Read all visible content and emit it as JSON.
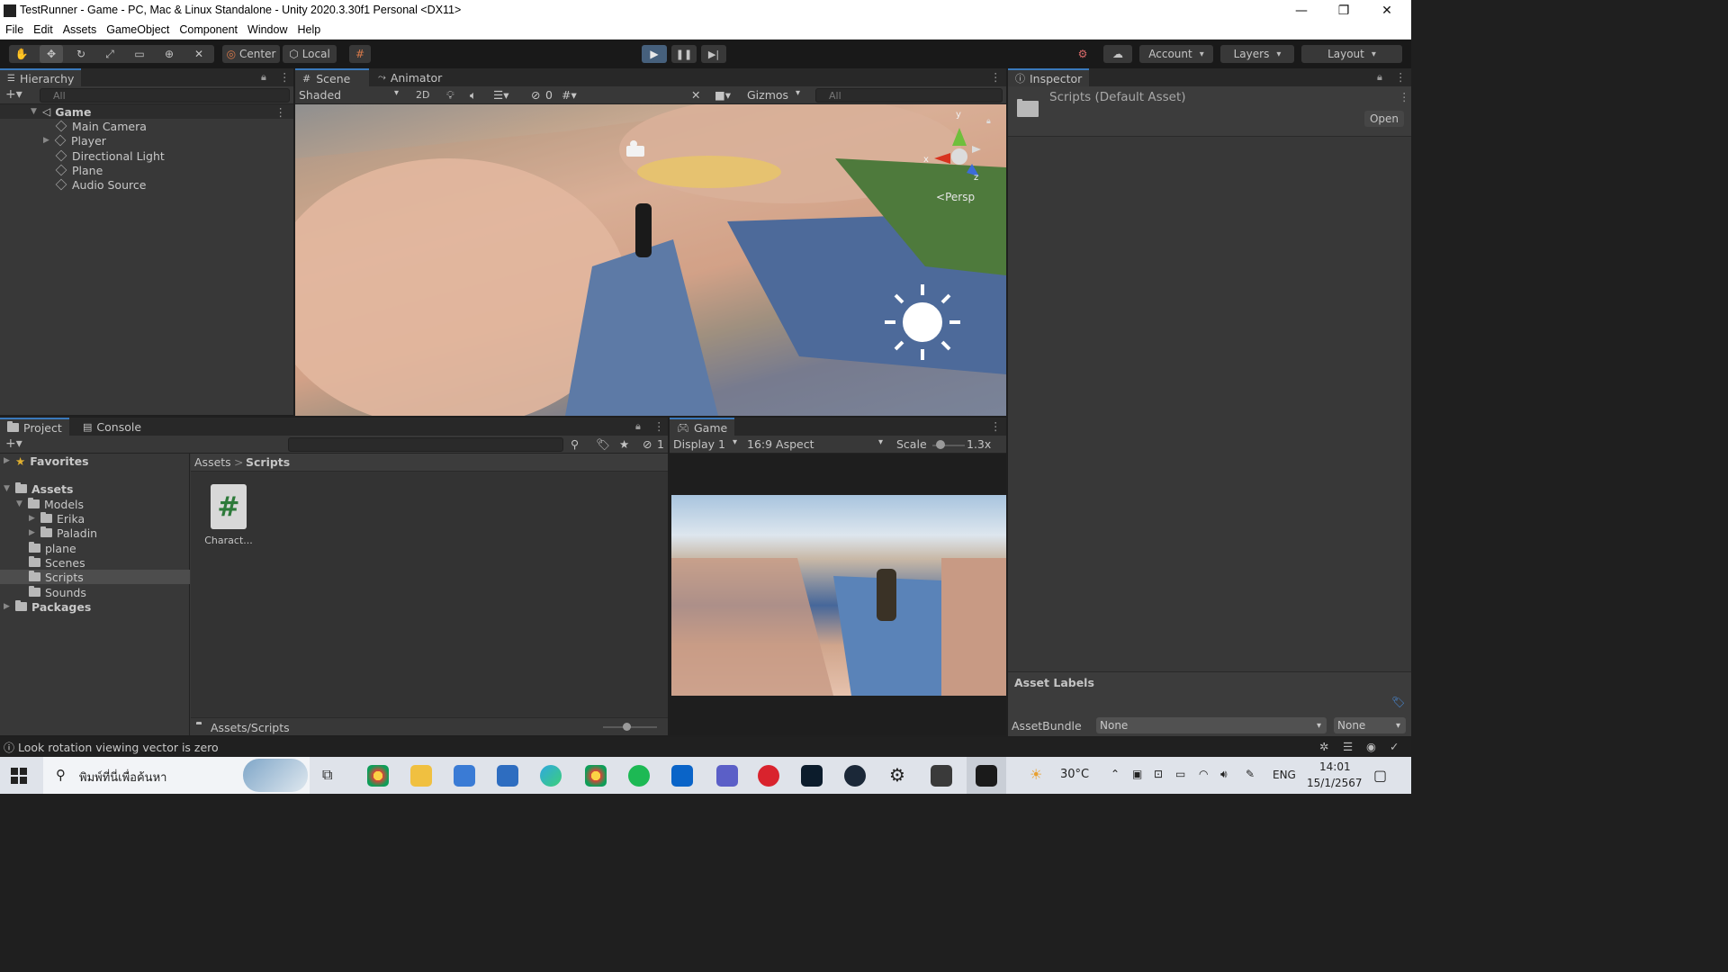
{
  "window": {
    "title": "TestRunner - Game - PC, Mac & Linux Standalone - Unity 2020.3.30f1 Personal <DX11>",
    "controls": {
      "minimize": "—",
      "maximize": "❐",
      "close": "✕"
    }
  },
  "menubar": [
    "File",
    "Edit",
    "Assets",
    "GameObject",
    "Component",
    "Window",
    "Help"
  ],
  "toolbar": {
    "pivot_label": "Center",
    "space_label": "Local",
    "account_label": "Account",
    "layers_label": "Layers",
    "layout_label": "Layout"
  },
  "hierarchy": {
    "tab_label": "Hierarchy",
    "search_placeholder": "All",
    "scene_name": "Game",
    "items": [
      "Main Camera",
      "Player",
      "Directional Light",
      "Plane",
      "Audio Source"
    ]
  },
  "scene": {
    "tabs": [
      "Scene",
      "Animator"
    ],
    "draw_mode": "Shaded",
    "mode_2d": "2D",
    "hidden_count": "0",
    "gizmos_label": "Gizmos",
    "search_placeholder": "All",
    "axis_labels": {
      "x": "x",
      "y": "y",
      "z": "z"
    },
    "projection_label": "Persp"
  },
  "inspector": {
    "tab_label": "Inspector",
    "asset_title": "Scripts (Default Asset)",
    "open_button": "Open",
    "asset_labels_title": "Asset Labels",
    "assetbundle_label": "AssetBundle",
    "assetbundle_value": "None",
    "variant_value": "None"
  },
  "project": {
    "tabs": [
      "Project",
      "Console"
    ],
    "hidden_count": "1",
    "favorites_label": "Favorites",
    "tree": {
      "assets": "Assets",
      "models": "Models",
      "erika": "Erika",
      "paladin": "Paladin",
      "plane": "plane",
      "scenes": "Scenes",
      "scripts": "Scripts",
      "sounds": "Sounds",
      "packages": "Packages"
    },
    "breadcrumb": [
      "Assets",
      "Scripts"
    ],
    "file": {
      "name": "Charact...",
      "glyph": "#"
    },
    "footer_path": "Assets/Scripts"
  },
  "game": {
    "tab_label": "Game",
    "display": "Display 1",
    "aspect": "16:9 Aspect",
    "scale_label": "Scale",
    "scale_value": "1.3x"
  },
  "statusbar": {
    "message": "Look rotation viewing vector is zero"
  },
  "taskbar": {
    "search_placeholder": "พิมพ์ที่นี่เพื่อค้นหา",
    "weather": "30°C",
    "language": "ENG",
    "time": "14:01",
    "date": "15/1/2567"
  },
  "colors": {
    "accent_blue": "#3a79bb",
    "play_button": "#46607c",
    "panel_bg": "#383838",
    "toolbar_bg": "#191919",
    "script_icon_green": "#2d7a3a"
  }
}
